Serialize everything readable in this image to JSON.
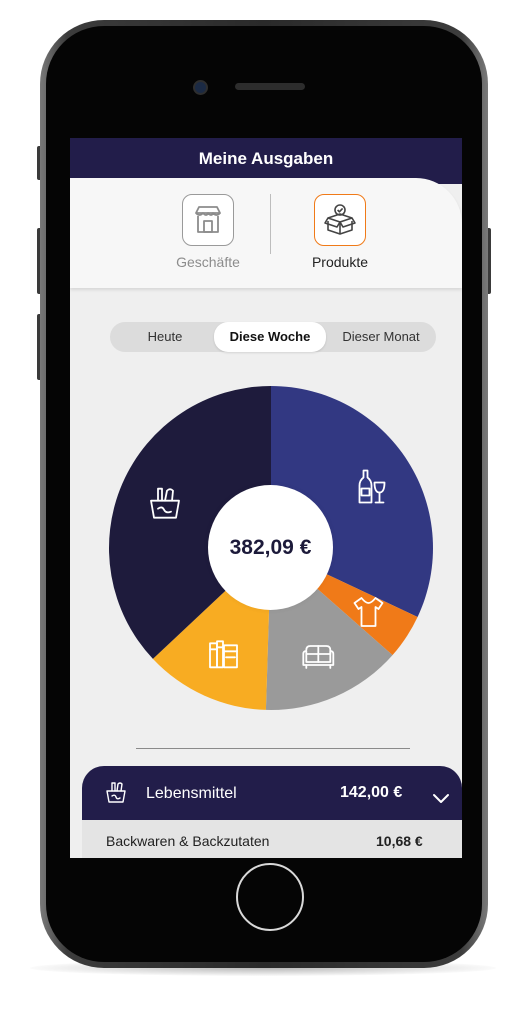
{
  "header": {
    "title": "Meine Ausgaben"
  },
  "view_switch": {
    "items": [
      {
        "label": "Geschäfte",
        "icon": "store-icon",
        "active": false
      },
      {
        "label": "Produkte",
        "icon": "box-icon",
        "active": true
      }
    ]
  },
  "period_tabs": {
    "items": [
      {
        "label": "Heute",
        "active": false
      },
      {
        "label": "Diese Woche",
        "active": true
      },
      {
        "label": "Dieser Monat",
        "active": false
      }
    ]
  },
  "total": {
    "value": "382,09 €"
  },
  "chart_data": {
    "type": "pie",
    "categories": [
      "Getränke",
      "Kleidung",
      "Möbel",
      "Bücher",
      "Lebensmittel"
    ],
    "category_icons": [
      "wine-bottle-glass-icon",
      "tshirt-icon",
      "sofa-icon",
      "books-icon",
      "grocery-bag-icon"
    ],
    "values": [
      0.32,
      0.045,
      0.14,
      0.125,
      0.37
    ],
    "colors": [
      "#323882",
      "#f07a18",
      "#9a9a9a",
      "#f8ac22",
      "#1e1b3c"
    ],
    "legend": false
  },
  "category_list": [
    {
      "name": "Lebensmittel",
      "amount": "142,00 €",
      "icon": "grocery-bag-icon",
      "sub_items": [
        {
          "name": "Backwaren & Backzutaten",
          "amount": "10,68 €"
        }
      ]
    }
  ],
  "colors": {
    "primary_dark": "#221d4a",
    "accent_orange": "#f07a18",
    "background": "#efefef"
  }
}
